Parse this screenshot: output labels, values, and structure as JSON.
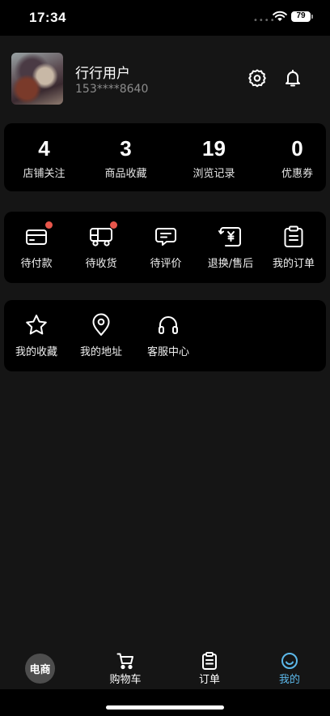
{
  "status_bar": {
    "time": "17:34",
    "battery": "79",
    "dots": "••••"
  },
  "profile": {
    "name": "行行用户",
    "phone": "153****8640"
  },
  "stats": [
    {
      "value": "4",
      "label": "店铺关注"
    },
    {
      "value": "3",
      "label": "商品收藏"
    },
    {
      "value": "19",
      "label": "浏览记录"
    },
    {
      "value": "0",
      "label": "优惠券"
    }
  ],
  "orders": [
    {
      "label": "待付款",
      "icon": "card-icon",
      "badge": true
    },
    {
      "label": "待收货",
      "icon": "truck-icon",
      "badge": true
    },
    {
      "label": "待评价",
      "icon": "comment-icon",
      "badge": false
    },
    {
      "label": "退换/售后",
      "icon": "yen-return-icon",
      "badge": false
    },
    {
      "label": "我的订单",
      "icon": "clipboard-icon",
      "badge": false
    }
  ],
  "tools": [
    {
      "label": "我的收藏",
      "icon": "star-icon"
    },
    {
      "label": "我的地址",
      "icon": "location-pin-icon"
    },
    {
      "label": "客服中心",
      "icon": "headset-icon"
    }
  ],
  "tabs": [
    {
      "label": "电商",
      "icon": "home-bubble"
    },
    {
      "label": "购物车",
      "icon": "cart-icon"
    },
    {
      "label": "订单",
      "icon": "clipboard-icon"
    },
    {
      "label": "我的",
      "icon": "smile-icon",
      "active": true
    }
  ],
  "colors": {
    "accent": "#5cb8ea",
    "badge": "#e8564b",
    "card": "#000000",
    "background": "#151515"
  }
}
